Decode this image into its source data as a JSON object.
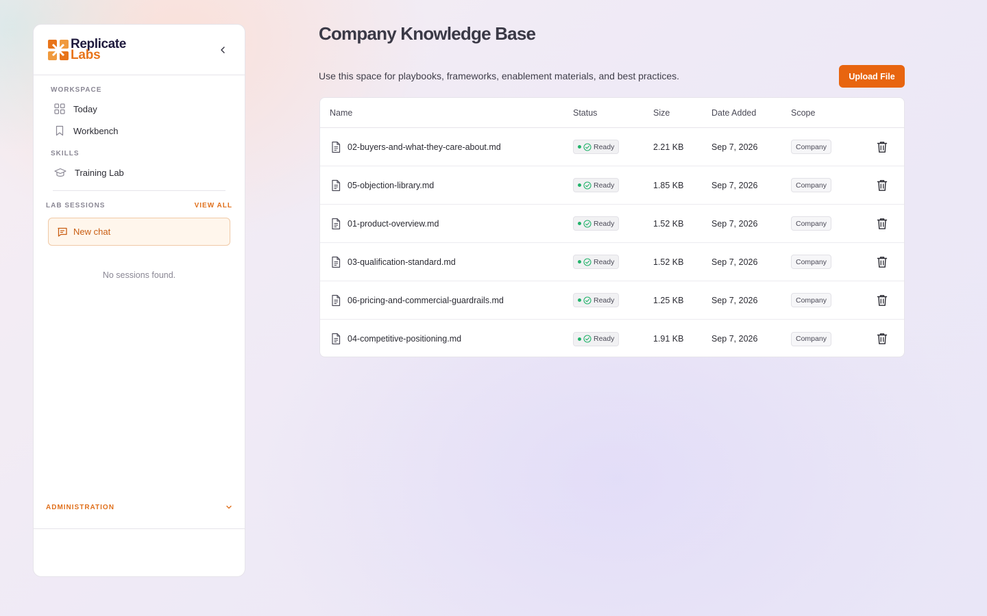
{
  "brand": {
    "line1": "Replicate",
    "line2": "Labs"
  },
  "sidebar": {
    "workspace_label": "WORKSPACE",
    "workspace_items": [
      {
        "label": "Today",
        "icon": "grid-icon"
      },
      {
        "label": "Workbench",
        "icon": "bookmark-icon"
      }
    ],
    "skills_label": "SKILLS",
    "skills_items": [
      {
        "label": "Training Lab",
        "icon": "graduation-cap-icon"
      }
    ],
    "sessions_label": "LAB SESSIONS",
    "view_all_label": "VIEW ALL",
    "new_chat_label": "New chat",
    "empty_sessions": "No sessions found.",
    "admin_label": "ADMINISTRATION"
  },
  "main": {
    "title": "Company Knowledge Base",
    "description": "Use this space for playbooks, frameworks, enablement materials, and best practices.",
    "upload_label": "Upload File",
    "columns": [
      "Name",
      "Status",
      "Size",
      "Date Added",
      "Scope"
    ],
    "files": [
      {
        "name": "02-buyers-and-what-they-care-about.md",
        "status": "Ready",
        "size": "2.21 KB",
        "date": "Sep 7, 2026",
        "scope": "Company"
      },
      {
        "name": "05-objection-library.md",
        "status": "Ready",
        "size": "1.85 KB",
        "date": "Sep 7, 2026",
        "scope": "Company"
      },
      {
        "name": "01-product-overview.md",
        "status": "Ready",
        "size": "1.52 KB",
        "date": "Sep 7, 2026",
        "scope": "Company"
      },
      {
        "name": "03-qualification-standard.md",
        "status": "Ready",
        "size": "1.52 KB",
        "date": "Sep 7, 2026",
        "scope": "Company"
      },
      {
        "name": "06-pricing-and-commercial-guardrails.md",
        "status": "Ready",
        "size": "1.25 KB",
        "date": "Sep 7, 2026",
        "scope": "Company"
      },
      {
        "name": "04-competitive-positioning.md",
        "status": "Ready",
        "size": "1.91 KB",
        "date": "Sep 7, 2026",
        "scope": "Company"
      }
    ]
  },
  "colors": {
    "accent": "#e8650f",
    "ready": "#22b36a",
    "brand_dark": "#1f1a3d"
  }
}
